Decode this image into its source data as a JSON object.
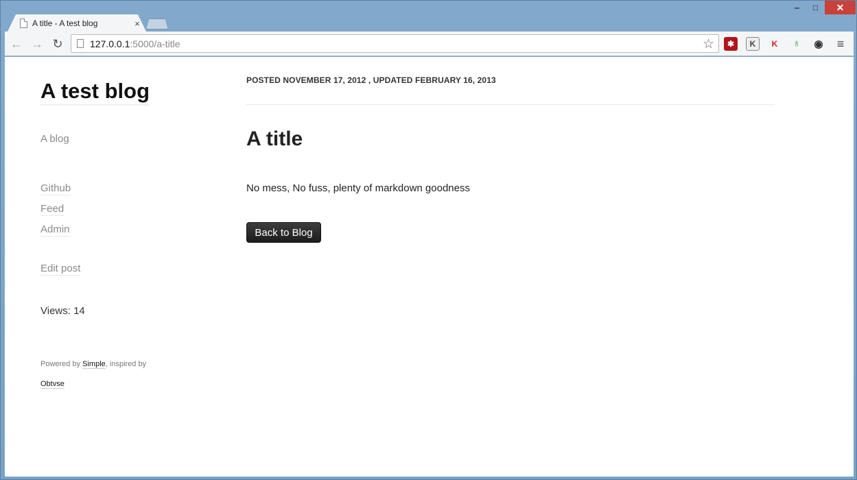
{
  "browser": {
    "tab_title": "A title - A test blog",
    "tab_close": "×",
    "url_host": "127.0.0.1",
    "url_path": ":5000/a-title",
    "window_controls": {
      "minimize": "‒",
      "maximize": "□",
      "close": "✕"
    },
    "back": "←",
    "forward": "→",
    "reload": "↻",
    "star": "☆",
    "menu": "≡",
    "extensions": [
      {
        "name": "lastpass-icon",
        "glyph": "✱",
        "color": "#c0141c"
      },
      {
        "name": "k-extension-icon",
        "glyph": "K",
        "color": "#555555"
      },
      {
        "name": "kaspersky-icon",
        "glyph": "K",
        "color": "#d0202a"
      },
      {
        "name": "evernote-icon",
        "glyph": "♁",
        "color": "#2aa33a"
      },
      {
        "name": "incognito-mask-icon",
        "glyph": "◉",
        "color": "#333333"
      }
    ]
  },
  "sidebar": {
    "blog_title": "A test blog",
    "description": "A blog",
    "links": [
      "Github",
      "Feed",
      "Admin"
    ],
    "edit_post": "Edit post",
    "views": "Views: 14",
    "powered_prefix": "Powered by ",
    "powered_link": "Simple",
    "powered_suffix": ", inspired by",
    "inspired_link": "Obtvse"
  },
  "post": {
    "meta": "POSTED NOVEMBER 17, 2012 , UPDATED FEBRUARY 16, 2013",
    "title": "A title",
    "body": "No mess, No fuss, plenty of markdown goodness",
    "back_button": "Back to Blog"
  }
}
